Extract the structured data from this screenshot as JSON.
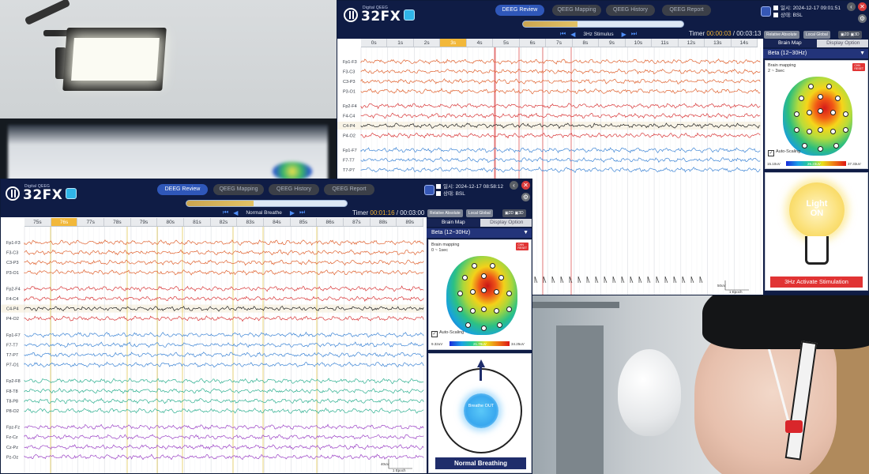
{
  "app": {
    "logo_sub": "Digital QEEG",
    "logo_text": "32FX",
    "nav_tabs": [
      "DEEG Review",
      "QEEG Mapping",
      "QEEG History",
      "QEEG Report"
    ]
  },
  "back_window": {
    "datetime": "일시: 2024-12-17 09:01:51",
    "state": "상태: BSL",
    "stimulus_label": "3Hz Stimulus",
    "timer_label": "Timer",
    "timer_elapsed": "00:00:03",
    "timer_total": "/ 00:03:13",
    "progress": 0.34,
    "time_ticks": [
      "0s",
      "1s",
      "2s",
      "3s",
      "4s",
      "5s",
      "6s",
      "7s",
      "8s",
      "9s",
      "10s",
      "11s",
      "12s",
      "13s",
      "14s"
    ],
    "highlight_tick": 3,
    "channels": [
      "Fp1-F3",
      "F3-C3",
      "C3-P3",
      "P3-O1",
      "Fp2-F4",
      "F4-C4",
      "C4-P4",
      "P4-O2",
      "Fp1-F7",
      "F7-T7",
      "T7-P7"
    ],
    "channel_colors": [
      "#e0622f",
      "#e0622f",
      "#e0622f",
      "#e0622f",
      "#d9393a",
      "#d9393a",
      "#222222",
      "#d9393a",
      "#3f86d6",
      "#3f86d6",
      "#3f86d6"
    ],
    "side": {
      "tab_map": "Brain Map",
      "tab_display": "Display Option",
      "band": "Beta (12~30Hz)",
      "map_title": "Brain mapping",
      "map_range": "2 ~ 3sec",
      "auto_scaling": "Auto-Scaling",
      "cb_min": "15.10uV",
      "cb_mid": "26.23uV",
      "cb_max": "37.33uV",
      "stim_light": "Light",
      "stim_on": "ON",
      "stim_button": "3Hz   Activate Stimulation"
    },
    "scale_label": "50uV",
    "epoch_label": "1 Epoch"
  },
  "front_window": {
    "datetime": "일시: 2024-12-17 08:58:12",
    "state": "상태: BSL",
    "stimulus_label": "Normal Breathe",
    "timer_label": "Timer",
    "timer_elapsed": "00:01:16",
    "timer_total": "/ 00:03:00",
    "progress": 0.42,
    "time_ticks": [
      "75s",
      "76s",
      "77s",
      "78s",
      "79s",
      "80s",
      "81s",
      "82s",
      "83s",
      "84s",
      "85s",
      "86s",
      "87s",
      "88s",
      "89s"
    ],
    "highlight_tick": 1,
    "tags": {
      "relative": "Relative",
      "absolute": "Absolute",
      "local": "Local",
      "global": "Global",
      "two_d": "2D",
      "three_d": "3D"
    },
    "channels": [
      "Fp1-F3",
      "F3-C3",
      "C3-P3",
      "P3-O1",
      "Fp2-F4",
      "F4-C4",
      "C4-P4",
      "P4-O2",
      "Fp1-F7",
      "F7-T7",
      "T7-P7",
      "P7-O1",
      "Fp2-F8",
      "F8-T8",
      "T8-P8",
      "P8-O2",
      "Fpz-Fz",
      "Fz-Cz",
      "Cz-Pz",
      "Pz-Oz"
    ],
    "channel_colors": [
      "#e0622f",
      "#e0622f",
      "#e0622f",
      "#e0622f",
      "#d9393a",
      "#d9393a",
      "#222222",
      "#d9393a",
      "#3f86d6",
      "#3f86d6",
      "#3f86d6",
      "#3f86d6",
      "#2fb091",
      "#2fb091",
      "#2fb091",
      "#2fb091",
      "#9c44c6",
      "#9c44c6",
      "#9c44c6",
      "#9c44c6"
    ],
    "side": {
      "tab_map": "Brain Map",
      "tab_display": "Display Option",
      "band": "Beta (12~30Hz)",
      "map_title": "Brain mapping",
      "map_range": "0 ~ 1sec",
      "auto_scaling": "Auto-Scaling",
      "cb_min": "9.32uV",
      "cb_mid": "21.78uV",
      "cb_max": "34.25uV",
      "breathe_core": "Breathe OUT",
      "breathe_button": "Normal Breathing"
    },
    "scale_label": "40uV",
    "epoch_label": "1 Epoch"
  }
}
